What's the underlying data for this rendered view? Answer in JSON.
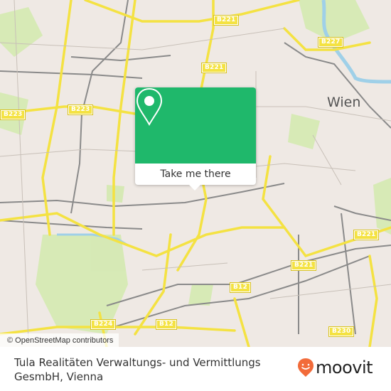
{
  "map": {
    "city_label": "Wien",
    "road_shields": [
      {
        "id": "b221-top",
        "label": "B221"
      },
      {
        "id": "b227",
        "label": "B227"
      },
      {
        "id": "b221-mid",
        "label": "B221"
      },
      {
        "id": "b223-left",
        "label": "B223"
      },
      {
        "id": "b223-center",
        "label": "B223"
      },
      {
        "id": "b221-right",
        "label": "B221"
      },
      {
        "id": "b221-lower",
        "label": "B221"
      },
      {
        "id": "b12-center",
        "label": "B12"
      },
      {
        "id": "b224",
        "label": "B224"
      },
      {
        "id": "b12-lower",
        "label": "B12"
      },
      {
        "id": "b230",
        "label": "B230"
      }
    ],
    "attribution": "© OpenStreetMap contributors",
    "colors": {
      "land": "#efe9e4",
      "park": "#d4eab0",
      "road_major": "#f4e242",
      "railway": "#8a8a8a",
      "water": "#9fd0e8"
    }
  },
  "popup": {
    "icon": "map-pin-icon",
    "button_label": "Take me there",
    "header_color": "#1fb86b"
  },
  "footer": {
    "title": "Tula Realitäten Verwaltungs- und Vermittlungs GesmbH, Vienna",
    "brand": {
      "name": "moovit",
      "icon": "moovit-logo-icon",
      "accent": "#f26b3a"
    }
  }
}
